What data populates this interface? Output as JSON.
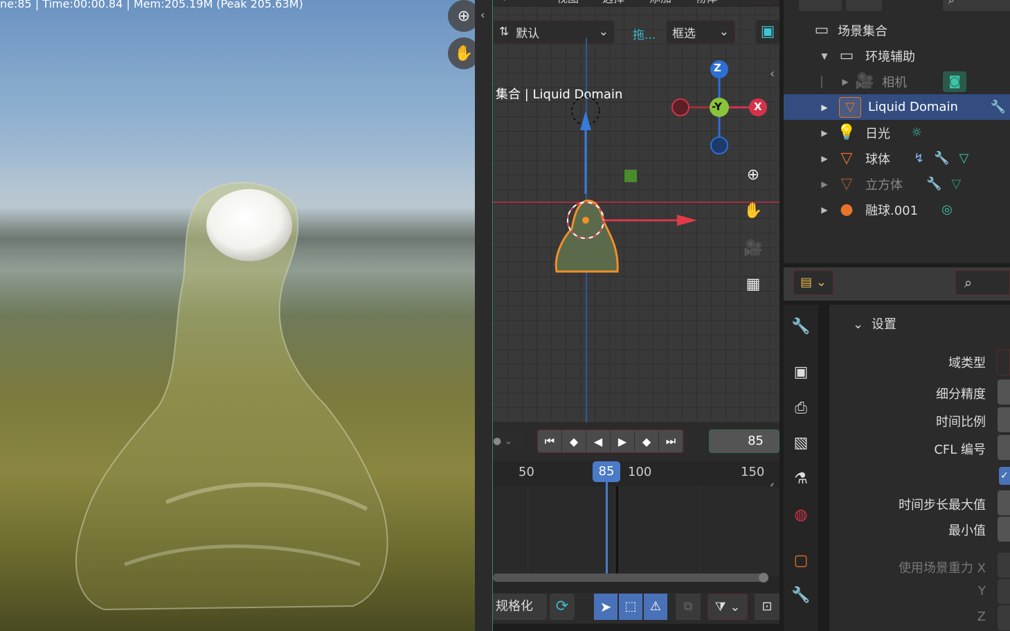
{
  "render_view": {
    "status": "ne:85 | Time:00:00.84 | Mem:205.19M (Peak 205.63M)",
    "zoom_icon": "zoom-in-icon",
    "pan_icon": "hand-pan-icon"
  },
  "viewport": {
    "top_menu": [
      "视图",
      "选择",
      "添加",
      "物体"
    ],
    "orientation_label": "默认",
    "drag_label": "拖...",
    "select_mode": "框选",
    "object_label": "集合 | Liquid Domain",
    "gizmo": {
      "z": "Z",
      "y": "-Y",
      "x": "X"
    }
  },
  "timeline": {
    "current_frame": "85",
    "ruler": [
      "50",
      "85",
      "100",
      "150"
    ],
    "footer_label": "规格化"
  },
  "outliner": {
    "root": "场景集合",
    "items": [
      {
        "name": "环境辅助"
      },
      {
        "name": "相机"
      },
      {
        "name": "Liquid Domain"
      },
      {
        "name": "日光"
      },
      {
        "name": "球体"
      },
      {
        "name": "立方体"
      },
      {
        "name": "融球.001"
      }
    ]
  },
  "properties": {
    "section": "设置",
    "labels": [
      "域类型",
      "细分精度",
      "时间比例",
      "CFL 编号",
      "时间步长最大值",
      "最小值",
      "使用场景重力 X",
      "Y",
      "Z"
    ]
  },
  "colors": {
    "selection": "#334d80",
    "accent_orange": "#e8742a",
    "axis_x": "#d4324a",
    "axis_y": "#8ac43a",
    "axis_z": "#2e6fd6",
    "teal": "#3cc4a4"
  }
}
